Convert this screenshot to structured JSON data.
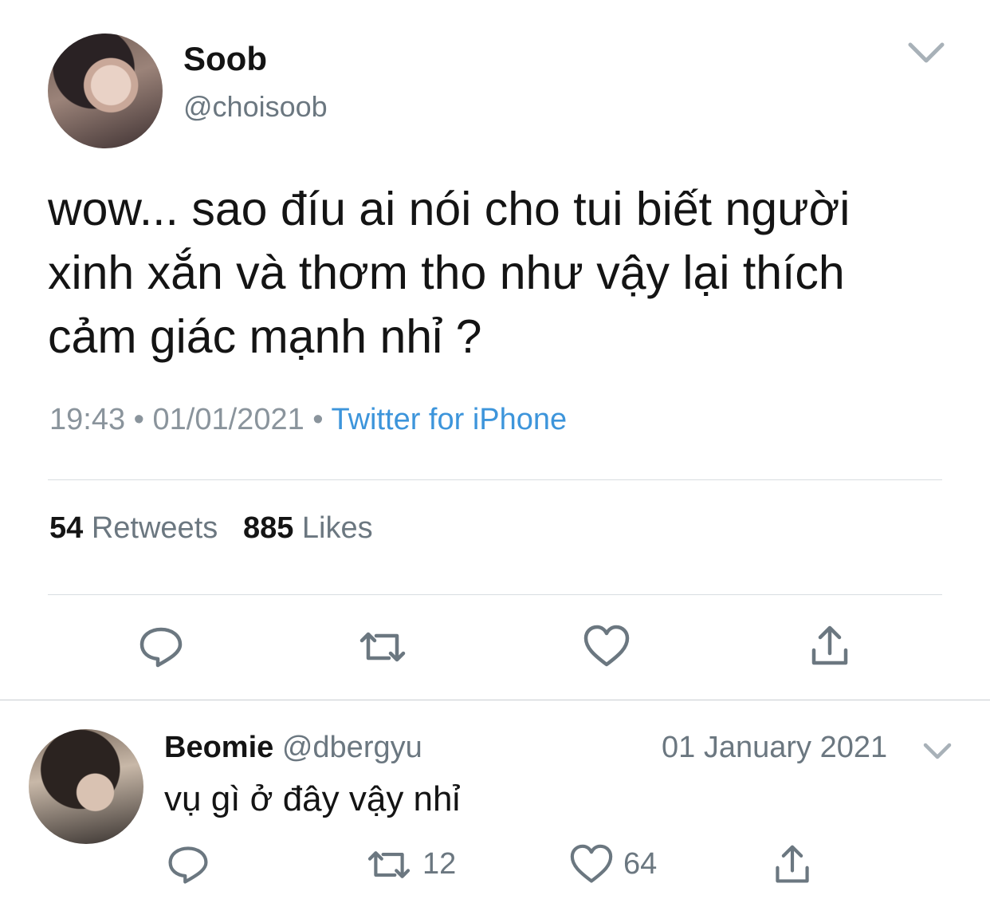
{
  "tweet": {
    "author_name": "Soob",
    "author_handle": "@choisoob",
    "text": "wow... sao đíu ai nói cho tui biết người xinh xắn và thơm tho như vậy lại thích cảm giác mạnh nhỉ ?",
    "time": "19:43",
    "date": "01/01/2021",
    "source": "Twitter for iPhone",
    "separator": "•",
    "retweets_count": "54",
    "retweets_label": "Retweets",
    "likes_count": "885",
    "likes_label": "Likes"
  },
  "reply": {
    "author_name": "Beomie",
    "author_handle": "@dbergyu",
    "date": "01 January 2021",
    "text": "vụ gì ở đây vậy nhỉ",
    "retweet_count": "12",
    "like_count": "64"
  },
  "icons": {
    "avatar_main": "avatar-photo",
    "chevron": "chevron-down-icon",
    "reply": "reply-bubble-icon",
    "retweet": "retweet-icon",
    "like": "heart-icon",
    "share": "share-icon"
  },
  "colors": {
    "text": "#141414",
    "secondary": "#6b7780",
    "link": "#3d95db",
    "icon": "#6b7780",
    "divider": "#d8dde1"
  }
}
